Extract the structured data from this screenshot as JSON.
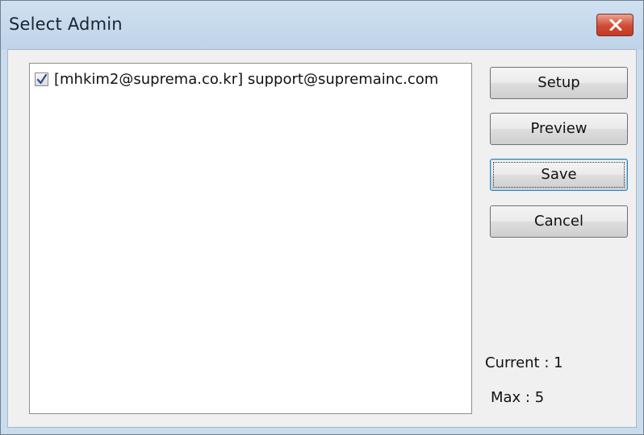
{
  "window": {
    "title": "Select Admin",
    "close_label": "×"
  },
  "list": {
    "items": [
      {
        "checked": true,
        "text": "[mhkim2@suprema.co.kr] support@supremainc.com"
      }
    ]
  },
  "buttons": {
    "setup": "Setup",
    "preview": "Preview",
    "save": "Save",
    "cancel": "Cancel"
  },
  "status": {
    "current": "Current : 1",
    "max": "Max : 5"
  },
  "colors": {
    "titlebar": "#c9dcee",
    "close_button": "#d24a33",
    "dialog_face": "#f0f0f0",
    "default_button_border": "#3c7fb1"
  }
}
